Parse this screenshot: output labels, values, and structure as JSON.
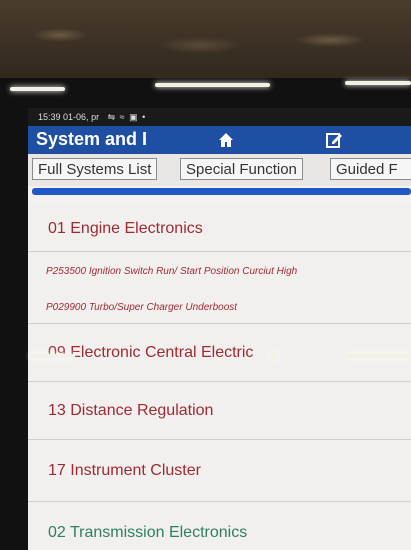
{
  "status_bar": {
    "time": "15:39",
    "date": "01-06, pr",
    "icons": [
      "wifi-icon",
      "signal-icon",
      "screen-icon",
      "dot-icon"
    ]
  },
  "header": {
    "title": "System and F",
    "home_icon": "home-icon",
    "edit_icon": "edit-icon"
  },
  "tabs": [
    {
      "label": "Full Systems List"
    },
    {
      "label": "Special Function"
    },
    {
      "label": "Guided F"
    }
  ],
  "progress": {
    "value": 1.0,
    "color": "#1f57c7"
  },
  "systems": [
    {
      "label": "01 Engine Electronics"
    },
    {
      "label": "09 Electronic Central Electric"
    },
    {
      "label": "13 Distance Regulation"
    },
    {
      "label": "17 Instrument Cluster"
    },
    {
      "label": "02 Transmission Electronics"
    }
  ],
  "fault_codes": [
    {
      "text": "P253500 Ignition Switch Run/ Start Position Curciut High"
    },
    {
      "text": "P029900 Turbo/Super Charger Underboost"
    }
  ],
  "colors": {
    "accent": "#1f4fa3",
    "item_text": "#9e2a32",
    "item_text_alt": "#2c7f62"
  }
}
